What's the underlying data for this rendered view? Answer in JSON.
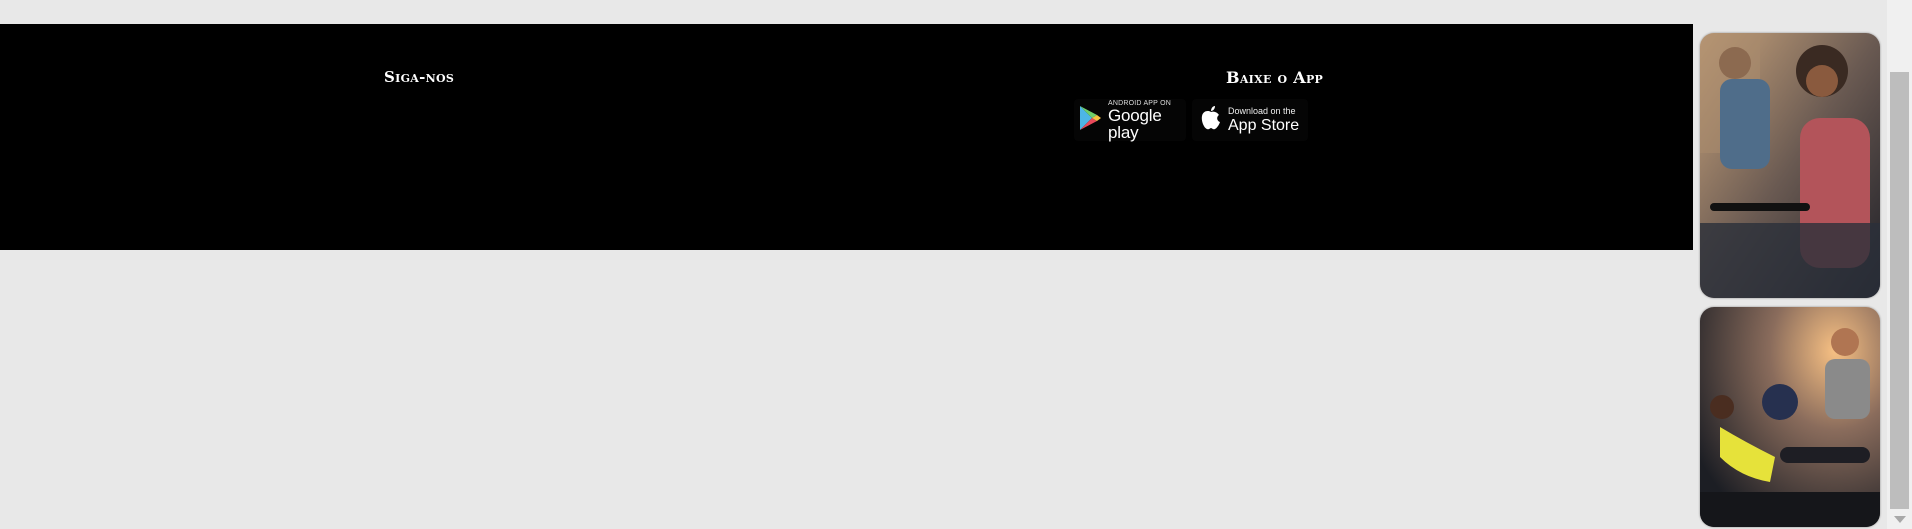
{
  "footer": {
    "follow": {
      "title": "Siga-nos"
    },
    "app": {
      "title": "Baixe o App",
      "google_play": {
        "small_label": "ANDROID APP ON",
        "label": "Google play"
      },
      "app_store": {
        "small_label": "Download on the",
        "label": "App Store"
      }
    }
  },
  "sidebar_ads": [
    {
      "subject": "people cycling in gym photo"
    },
    {
      "subject": "trainer helping woman with medicine ball photo"
    }
  ],
  "colors": {
    "page_bg": "#e8e8e8",
    "footer_bg": "#000000",
    "scrollbar_thumb": "#bdbdbd"
  }
}
